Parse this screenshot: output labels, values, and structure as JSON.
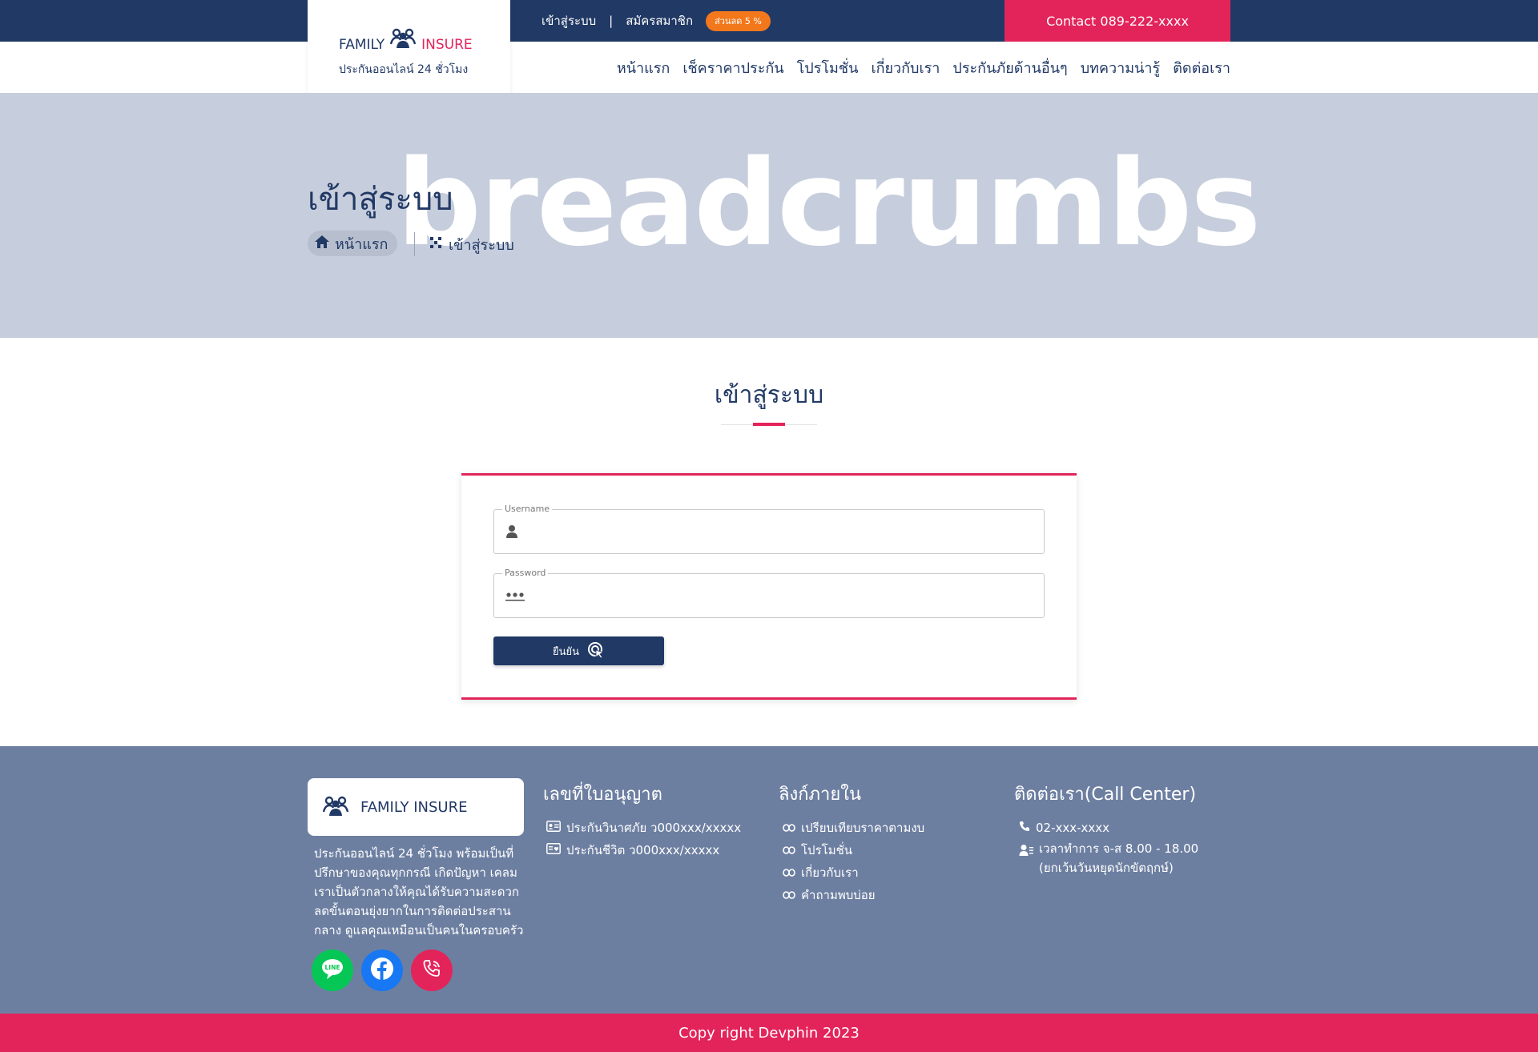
{
  "topbar": {
    "login_link": "เข้าสู่ระบบ",
    "separator": "|",
    "register_link": "สมัครสมาชิก",
    "discount_badge": "ส่วนลด 5 %",
    "contact": "Contact 089-222-xxxx"
  },
  "logo": {
    "family": "FAMILY",
    "insure": "INSURE",
    "tagline": "ประกันออนไลน์ 24 ชั่วโมง",
    "icon": "family-icon"
  },
  "nav": {
    "items": [
      "หน้าแรก",
      "เช็คราคาประกัน",
      "โปรโมชั่น",
      "เกี่ยวกับเรา",
      "ประกันภัยด้านอื่นๆ",
      "บทความน่ารู้",
      "ติดต่อเรา"
    ]
  },
  "hero": {
    "watermark": "breadcrumbs",
    "title": "เข้าสู่ระบบ",
    "breadcrumb_home": "หน้าแรก",
    "breadcrumb_current": "เข้าสู่ระบบ"
  },
  "login": {
    "heading": "เข้าสู่ระบบ",
    "username_label": "Username",
    "username_value": "",
    "password_label": "Password",
    "password_value": "",
    "submit_label": "ยืนยัน"
  },
  "footer": {
    "brand": "FAMILY INSURE",
    "description": "ประกันออนไลน์ 24 ชั่วโมง พร้อมเป็นที่ปรึกษาของคุณทุกกรณี เกิดปัญหา เคลม เราเป็นตัวกลางให้คุณได้รับความสะดวก ลดขั้นตอนยุ่งยากในการติดต่อประสานกลาง ดูแลคุณเหมือนเป็นคนในครอบครัว",
    "license": {
      "heading": "เลขที่ใบอนุญาต",
      "items": [
        "ประกันวินาศภัย ว000xxx/xxxxx",
        "ประกันชีวิต ว000xxx/xxxxx"
      ]
    },
    "links": {
      "heading": "ลิงก์ภายใน",
      "items": [
        "เปรียบเทียบราคาตามงบ",
        "โปรโมชั่น",
        "เกี่ยวกับเรา",
        "คำถามพบบ่อย"
      ]
    },
    "contact": {
      "heading": "ติดต่อเรา(Call Center)",
      "phone": "02-xxx-xxxx",
      "hours": "เวลาทำการ จ-ส 8.00 - 18.00",
      "hours_note": "(ยกเว้นวันหยุดนักขัตฤกษ์)"
    },
    "social": {
      "line_text": "LINE"
    },
    "copyright": "Copy right Devphin 2023"
  },
  "colors": {
    "navy": "#213965",
    "accent": "#e3245a",
    "badge": "#f3781c",
    "hero_bg": "#c6cddc",
    "footer_bg": "#6d7fa1",
    "line_green": "#06c755",
    "facebook_blue": "#1877f2"
  }
}
